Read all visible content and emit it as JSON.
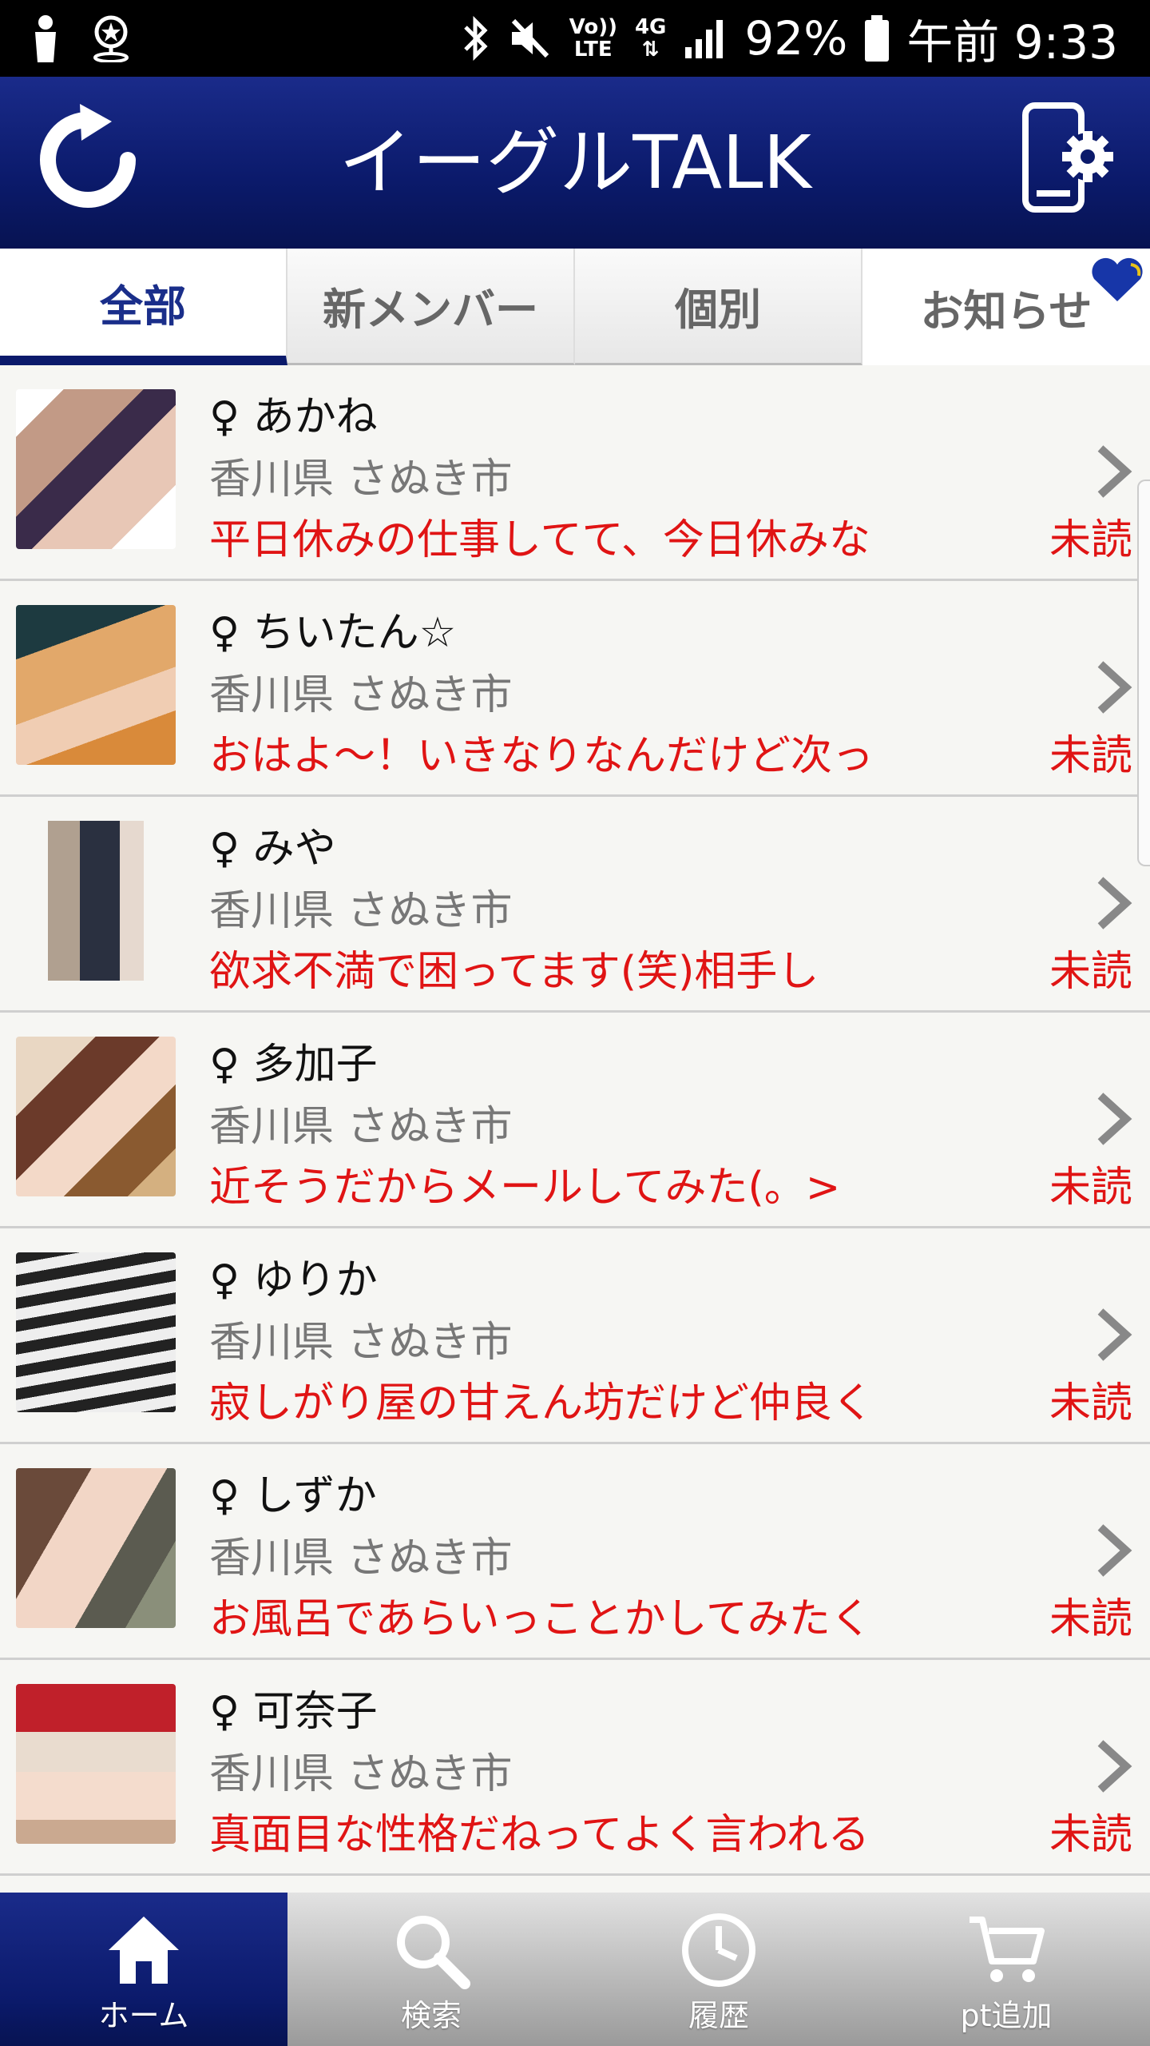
{
  "status_bar": {
    "battery": "92%",
    "time": "午前 9:33",
    "network_top": "Vo))",
    "network_bottom": "LTE",
    "signal_label": "4G"
  },
  "header": {
    "title": "イーグルTALK"
  },
  "tabs": [
    {
      "label": "全部"
    },
    {
      "label": "新メンバー"
    },
    {
      "label": "個別"
    },
    {
      "label": "お知らせ"
    }
  ],
  "members": [
    {
      "name": "♀ あかね",
      "location": "香川県 さぬき市",
      "message": "平日休みの仕事してて、今日休みな",
      "status": "未読"
    },
    {
      "name": "♀ ちいたん☆",
      "location": "香川県 さぬき市",
      "message": "おはよ～！いきなりなんだけど次っ",
      "status": "未読"
    },
    {
      "name": "♀ みや",
      "location": "香川県 さぬき市",
      "message": "欲求不満で困ってます(笑)相手し",
      "status": "未読"
    },
    {
      "name": "♀ 多加子",
      "location": "香川県 さぬき市",
      "message": "近そうだからメールしてみた(。>",
      "status": "未読"
    },
    {
      "name": "♀ ゆりか",
      "location": "香川県 さぬき市",
      "message": "寂しがり屋の甘えん坊だけど仲良く",
      "status": "未読"
    },
    {
      "name": "♀ しずか",
      "location": "香川県 さぬき市",
      "message": "お風呂であらいっことかしてみたく",
      "status": "未読"
    },
    {
      "name": "♀ 可奈子",
      "location": "香川県 さぬき市",
      "message": "真面目な性格だねってよく言われる",
      "status": "未読"
    }
  ],
  "bottom_nav": [
    {
      "label": "ホーム",
      "icon": "home-icon"
    },
    {
      "label": "検索",
      "icon": "search-icon"
    },
    {
      "label": "履歴",
      "icon": "clock-icon"
    },
    {
      "label": "pt追加",
      "icon": "cart-icon"
    }
  ],
  "colors": {
    "brand_navy": "#0b1a6b",
    "message_red": "#e01414",
    "heart_blue": "#1736a8"
  }
}
